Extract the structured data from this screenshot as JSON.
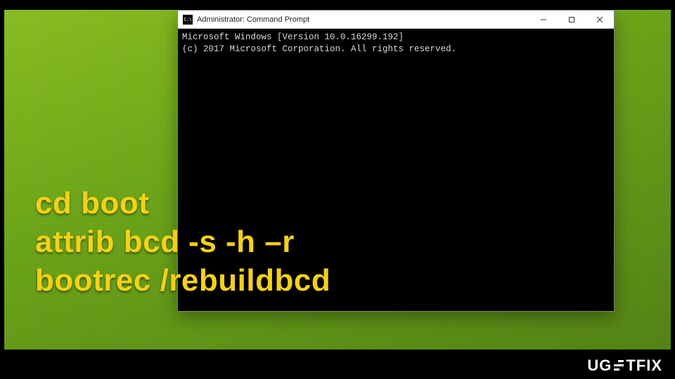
{
  "window": {
    "title": "Administrator: Command Prompt",
    "icon_label": "C:\\"
  },
  "terminal": {
    "line1": "Microsoft Windows [Version 10.0.16299.192]",
    "line2": "(c) 2017 Microsoft Corporation. All rights reserved."
  },
  "overlay": {
    "line1": "cd boot",
    "line2": "attrib bcd -s -h –r",
    "line3": "bootrec /rebuildbcd"
  },
  "watermark": {
    "pre": "UG",
    "post": "TFIX"
  }
}
